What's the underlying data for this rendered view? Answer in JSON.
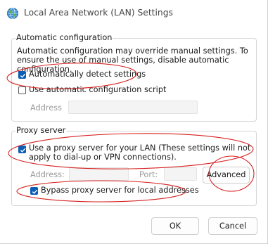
{
  "window": {
    "title": "Local Area Network (LAN) Settings",
    "icon": "globe-network-icon"
  },
  "auto_config": {
    "group_label": "Automatic configuration",
    "description": "Automatic configuration may override manual settings.  To ensure the use of manual settings, disable automatic configuration.",
    "detect_label": "Automatically detect settings",
    "detect_checked": true,
    "script_label": "Use automatic configuration script",
    "script_checked": false,
    "address_label": "Address",
    "address_value": ""
  },
  "proxy": {
    "group_label": "Proxy server",
    "use_proxy_label": "Use a proxy server for your LAN (These settings will not apply to dial-up or VPN connections).",
    "use_proxy_checked": true,
    "address_label": "Address:",
    "address_value": "",
    "port_label": "Port:",
    "port_value": "",
    "advanced_label": "Advanced",
    "bypass_label": "Bypass proxy server for local addresses",
    "bypass_checked": true
  },
  "buttons": {
    "ok_label": "OK",
    "cancel_label": "Cancel"
  },
  "colors": {
    "accent": "#0a5fb4",
    "annotation": "#d62020"
  }
}
